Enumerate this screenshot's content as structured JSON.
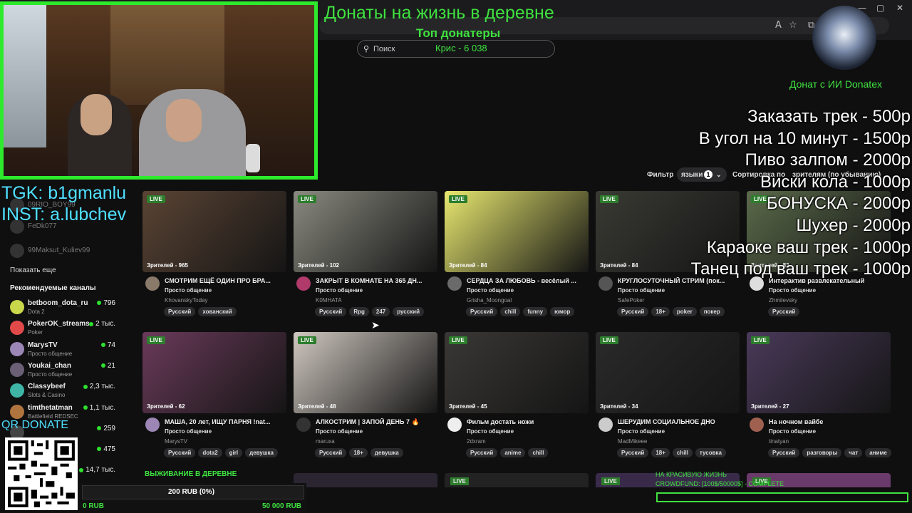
{
  "overlay": {
    "stream_title": "Донаты на жизнь в деревне",
    "top_donors_label": "Топ донатеры",
    "top_donor_entry": "Крис - 6 038",
    "tgk": "TGK: b1gmanlu",
    "inst": "INST: a.lubchev",
    "ai_donate": "Донат с ИИ Donatex",
    "price_list": [
      "Заказать трек - 500р",
      "В угол на 10 минут - 1500р",
      "Пиво залпом - 2000р",
      "Виски кола - 1000р",
      "БОНУСКА - 2000р",
      "Шухер - 2000р",
      "Караоке ваш трек - 1000р",
      "Танец под ваш трек - 1000р"
    ],
    "qr_label": "QR DONATE",
    "goal_value": "200 RUB (0%)",
    "goal_min": "0 RUB",
    "goal_max": "50 000 RUB",
    "survival_label": "ВЫЖИВАНИЕ В ДЕРЕВНЕ",
    "crowdfund_title": "НА КРАСИВУЮ ЖИЗНЬ",
    "crowdfund_status": "CROWDFUND: [100$/50000$] - COMPLETE"
  },
  "browser": {
    "window_controls": [
      "—",
      "▢",
      "✕"
    ],
    "addr_icons": [
      "A",
      "☆",
      "⧉"
    ]
  },
  "search": {
    "placeholder": "Поиск",
    "icon": "search-icon"
  },
  "filters": {
    "filter_label": "Фильтр",
    "languages_label": "языки",
    "languages_count": "1",
    "sort_label": "Сортировка по",
    "sort_value": "зрителям (по убыванию)"
  },
  "sidebar": {
    "followed": [
      "09RIO_BOY99",
      "FeDk077",
      "99Maksut_Kuliev99"
    ],
    "show_more": "Показать еще",
    "recommended_header": "Рекомендуемые каналы",
    "recommended": [
      {
        "name": "betboom_dota_ru",
        "category": "Dota 2",
        "count": "796",
        "color": "#c9d84a"
      },
      {
        "name": "PokerOK_streams",
        "category": "Poker",
        "count": "2 тыс.",
        "color": "#e24a4a"
      },
      {
        "name": "MarysTV",
        "category": "Просто общение",
        "count": "74",
        "color": "#9b86b5"
      },
      {
        "name": "Youkai_chan",
        "category": "Просто общение",
        "count": "21",
        "color": "#6a5f74"
      },
      {
        "name": "Classybeef",
        "category": "Slots & Casino",
        "count": "2,3 тыс.",
        "color": "#3fb5a6"
      },
      {
        "name": "timthetatman",
        "category": "Battlefield REDSEC",
        "count": "1,1 тыс.",
        "color": "#b0743f"
      },
      {
        "name": "",
        "category": "",
        "count": "259",
        "color": "#444"
      },
      {
        "name": "",
        "category": "",
        "count": "475",
        "color": "#444"
      },
      {
        "name": "",
        "category": "",
        "count": "14,7 тыс.",
        "color": "#444"
      }
    ]
  },
  "cards": [
    {
      "viewers": "Зрителей - 965",
      "title": "СМОТРИМ ЕЩЁ ОДИН ПРО БРА...",
      "category": "Просто общение",
      "channel": "KhovanskyToday",
      "tags": [
        "Русский",
        "хованский"
      ],
      "thumb": "#5b4434",
      "avatar": "#8a7a6a"
    },
    {
      "viewers": "Зрителей - 102",
      "title": "ЗАКРЫТ В КОМНАТЕ НА 365 ДН...",
      "category": "Просто общение",
      "channel": "K0MHATA",
      "tags": [
        "Русский",
        "Rpg",
        "247",
        "русский"
      ],
      "thumb": "#8a8a80",
      "avatar": "#b03a6a"
    },
    {
      "viewers": "Зрителей - 84",
      "title": "СЕРДЦА ЗА ЛЮБОВЬ - весёлый ...",
      "category": "Просто общение",
      "channel": "Grisha_Moongoal",
      "tags": [
        "Русский",
        "chill",
        "funny",
        "юмор"
      ],
      "thumb": "#e8e870",
      "avatar": "#6a6a6a"
    },
    {
      "viewers": "Зрителей - 84",
      "title": "КРУГЛОСУТОЧНЫЙ СТРИМ (пок...",
      "category": "Просто общение",
      "channel": "SafePoker",
      "tags": [
        "Русский",
        "18+",
        "poker",
        "покер"
      ],
      "thumb": "#3a3a34",
      "avatar": "#555"
    },
    {
      "viewers": "Зрителей - 83",
      "title": "Интерактив развлекательный",
      "category": "Просто общение",
      "channel": "Zhmilevsky",
      "tags": [
        "Русский"
      ],
      "thumb": "#5a6a4a",
      "avatar": "#ddd"
    },
    {
      "viewers": "Зрителей - 62",
      "title": "МАША, 20 лет, ИЩУ ПАРНЯ !nat...",
      "category": "Просто общение",
      "channel": "MarysTV",
      "tags": [
        "Русский",
        "dota2",
        "girl",
        "девушка"
      ],
      "thumb": "#6a3a5a",
      "avatar": "#9b86b5"
    },
    {
      "viewers": "Зрителей - 48",
      "title": "АЛКОСТРИМ | ЗАПОЙ ДЕНЬ 7 🔥",
      "category": "Просто общение",
      "channel": "maruxa",
      "tags": [
        "Русский",
        "18+",
        "девушка"
      ],
      "thumb": "#d0c8c0",
      "avatar": "#333"
    },
    {
      "viewers": "Зрителей - 45",
      "title": "Фильм достать ножи",
      "category": "Просто общение",
      "channel": "2dxram",
      "tags": [
        "Русский",
        "anime",
        "chill"
      ],
      "thumb": "#3a3836",
      "avatar": "#eee"
    },
    {
      "viewers": "Зрителей - 34",
      "title": "ШЕРУДИМ СОЦИАЛЬНОЕ ДНО",
      "category": "Просто общение",
      "channel": "MadMikeee",
      "tags": [
        "Русский",
        "18+",
        "chill",
        "тусовка"
      ],
      "thumb": "#2a2a2a",
      "avatar": "#ccc"
    },
    {
      "viewers": "Зрителей - 27",
      "title": "На ночном вайбе",
      "category": "Просто общение",
      "channel": "tinatyan",
      "tags": [
        "Русский",
        "разговоры",
        "чат",
        "аниме"
      ],
      "thumb": "#4a3a5a",
      "avatar": "#a06050"
    }
  ],
  "live_label": "LIVE",
  "colors": {
    "accent": "#3fe23f",
    "cyan": "#4fe0ff",
    "live": "#2d7d2d"
  }
}
